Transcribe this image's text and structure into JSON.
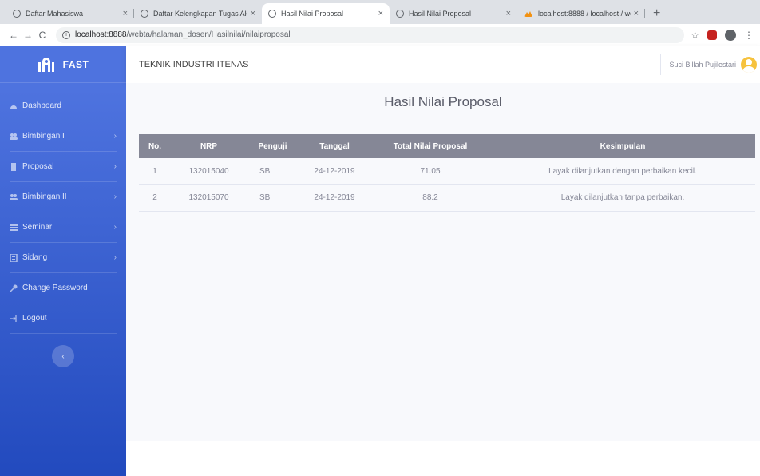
{
  "browser": {
    "tabs": [
      {
        "title": "Daftar Mahasiswa",
        "active": false
      },
      {
        "title": "Daftar Kelengkapan Tugas Akh",
        "active": false
      },
      {
        "title": "Hasil Nilai Proposal",
        "active": true
      },
      {
        "title": "Hasil Nilai Proposal",
        "active": false
      },
      {
        "title": "localhost:8888 / localhost / we",
        "active": false
      }
    ],
    "new_tab": "+",
    "url_host": "localhost:8888",
    "url_path": "/webta/halaman_dosen/Hasilnilai/nilaiproposal"
  },
  "sidebar": {
    "brand": "FAST",
    "items": [
      {
        "label": "Dashboard",
        "icon": "dashboard-icon",
        "has_submenu": false
      },
      {
        "label": "Bimbingan I",
        "icon": "users-icon",
        "has_submenu": true
      },
      {
        "label": "Proposal",
        "icon": "file-icon",
        "has_submenu": true
      },
      {
        "label": "Bimbingan II",
        "icon": "users-icon",
        "has_submenu": true
      },
      {
        "label": "Seminar",
        "icon": "list-icon",
        "has_submenu": true
      },
      {
        "label": "Sidang",
        "icon": "list-icon",
        "has_submenu": true
      },
      {
        "label": "Change Password",
        "icon": "key-icon",
        "has_submenu": false
      },
      {
        "label": "Logout",
        "icon": "sign-out-icon",
        "has_submenu": false
      }
    ]
  },
  "topbar": {
    "institution": "TEKNIK INDUSTRI ITENAS",
    "user_name": "Suci Billah Pujilestari"
  },
  "main": {
    "title": "Hasil Nilai Proposal",
    "table": {
      "headers": [
        "No.",
        "NRP",
        "Penguji",
        "Tanggal",
        "Total Nilai Proposal",
        "Kesimpulan"
      ],
      "rows": [
        [
          "1",
          "132015040",
          "SB",
          "24-12-2019",
          "71.05",
          "Layak dilanjutkan dengan perbaikan kecil."
        ],
        [
          "2",
          "132015070",
          "SB",
          "24-12-2019",
          "88.2",
          "Layak dilanjutkan tanpa perbaikan."
        ]
      ]
    }
  },
  "colors": {
    "sidebar_top": "#4e73df",
    "sidebar_bottom": "#224abe",
    "table_header": "#858796",
    "avatar": "#f6c23e"
  }
}
